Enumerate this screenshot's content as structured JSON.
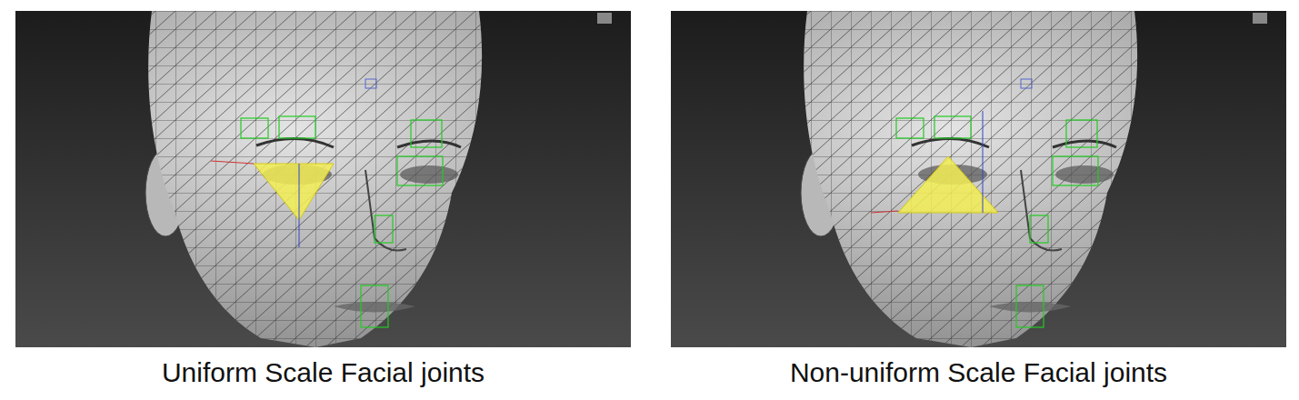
{
  "panels": [
    {
      "caption": "Uniform Scale Facial joints",
      "kind": "uniform"
    },
    {
      "caption": "Non-uniform Scale Facial joints",
      "kind": "nonuniform"
    }
  ]
}
